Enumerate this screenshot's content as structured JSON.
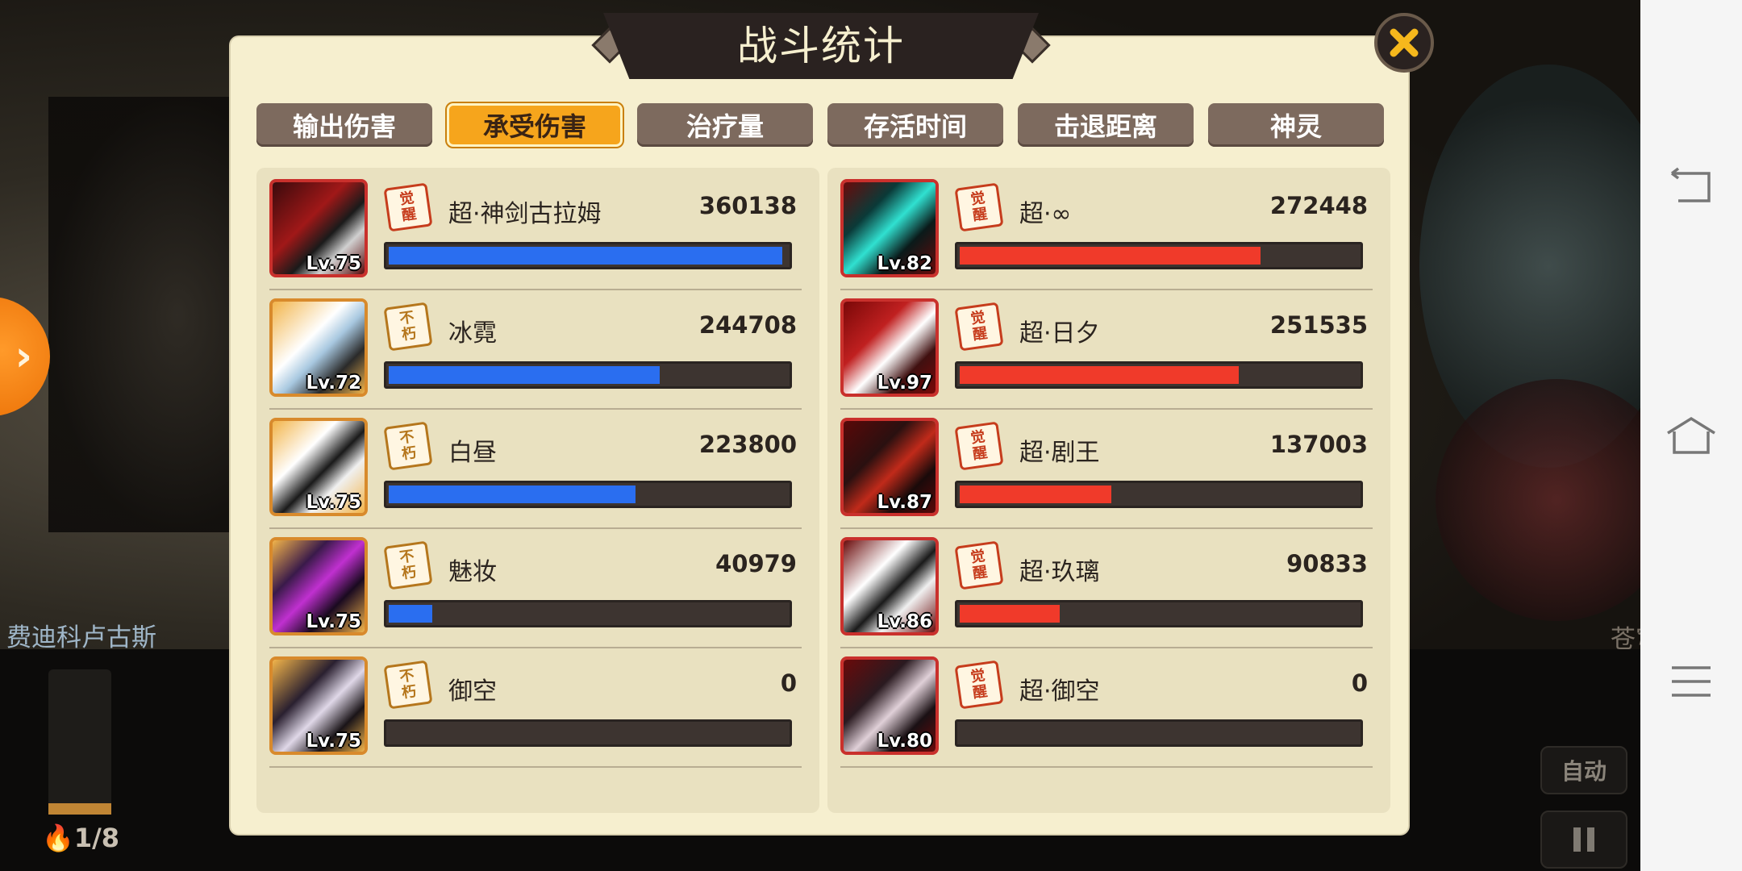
{
  "background": {
    "left_hero_name": "费迪科卢古斯",
    "right_hero_name": "苍穹丶九霄",
    "energy_text": "1/8",
    "auto_label": "自动"
  },
  "panel": {
    "title": "战斗统计",
    "close_icon": "close-x-icon"
  },
  "tabs": [
    {
      "label": "输出伤害",
      "active": false
    },
    {
      "label": "承受伤害",
      "active": true
    },
    {
      "label": "治疗量",
      "active": false
    },
    {
      "label": "存活时间",
      "active": false
    },
    {
      "label": "击退距离",
      "active": false
    },
    {
      "label": "神灵",
      "active": false
    }
  ],
  "colors": {
    "left_bar": "#2a6ef0",
    "right_bar": "#f03a2a",
    "active_tab": "#f6a51c",
    "panel_bg": "#f6efcf"
  },
  "left_team": [
    {
      "badge": [
        "觉",
        "醒"
      ],
      "badge_type": "awaken",
      "name": "超·神剑古拉姆",
      "value": "360138",
      "level": "Lv.75",
      "fill": 0.987
    },
    {
      "badge": [
        "不",
        "朽"
      ],
      "badge_type": "immortal",
      "name": "冰霓",
      "value": "244708",
      "level": "Lv.72",
      "fill": 0.68
    },
    {
      "badge": [
        "不",
        "朽"
      ],
      "badge_type": "immortal",
      "name": "白昼",
      "value": "223800",
      "level": "Lv.75",
      "fill": 0.62
    },
    {
      "badge": [
        "不",
        "朽"
      ],
      "badge_type": "immortal",
      "name": "魅妆",
      "value": "40979",
      "level": "Lv.75",
      "fill": 0.11
    },
    {
      "badge": [
        "不",
        "朽"
      ],
      "badge_type": "immortal",
      "name": "御空",
      "value": "0",
      "level": "Lv.75",
      "fill": 0
    }
  ],
  "right_team": [
    {
      "badge": [
        "觉",
        "醒"
      ],
      "badge_type": "awaken",
      "name": "超·∞",
      "value": "272448",
      "level": "Lv.82",
      "fill": 0.755
    },
    {
      "badge": [
        "觉",
        "醒"
      ],
      "badge_type": "awaken",
      "name": "超·日夕",
      "value": "251535",
      "level": "Lv.97",
      "fill": 0.7
    },
    {
      "badge": [
        "觉",
        "醒"
      ],
      "badge_type": "awaken",
      "name": "超·剧王",
      "value": "137003",
      "level": "Lv.87",
      "fill": 0.38
    },
    {
      "badge": [
        "觉",
        "醒"
      ],
      "badge_type": "awaken",
      "name": "超·玖璃",
      "value": "90833",
      "level": "Lv.86",
      "fill": 0.25
    },
    {
      "badge": [
        "觉",
        "醒"
      ],
      "badge_type": "awaken",
      "name": "超·御空",
      "value": "0",
      "level": "Lv.80",
      "fill": 0
    }
  ]
}
